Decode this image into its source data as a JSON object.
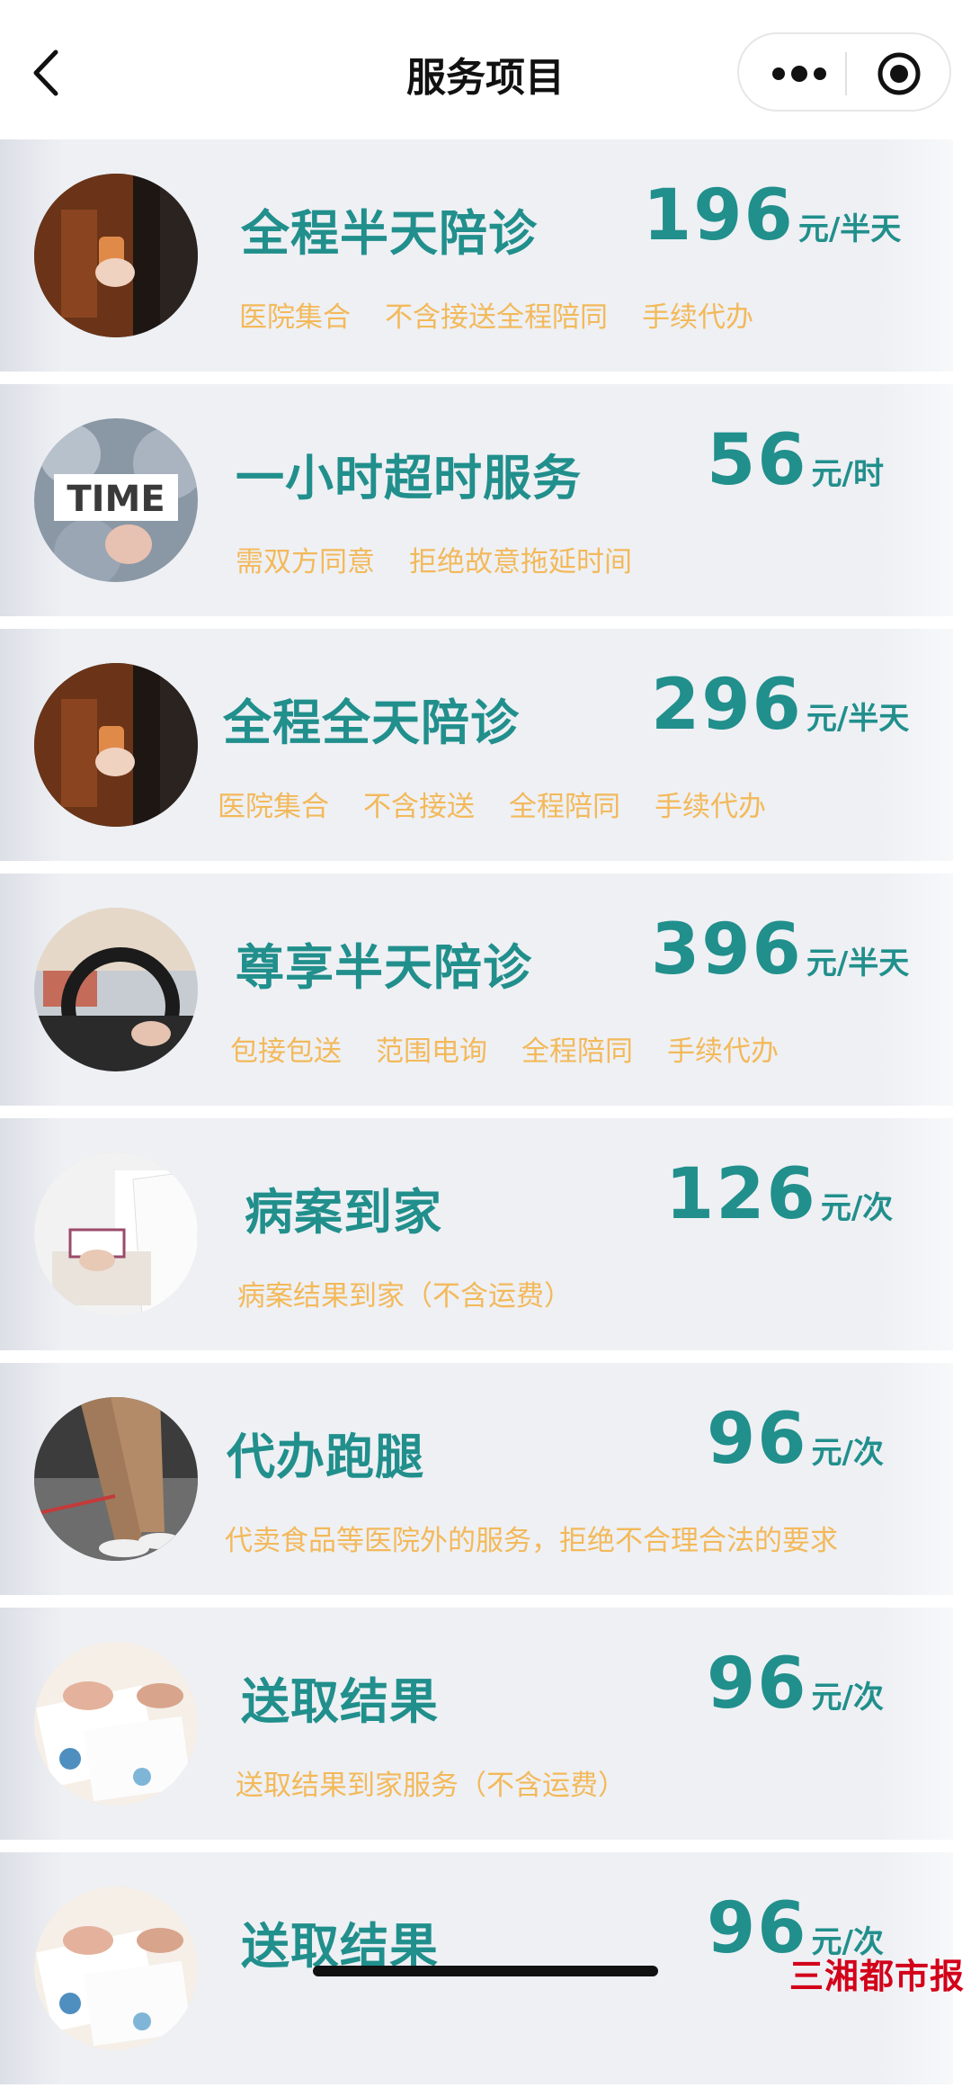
{
  "header": {
    "title": "服务项目",
    "back_icon": "chevron-left-icon",
    "more_icon": "more-dots-icon",
    "close_icon": "target-circle-icon"
  },
  "services": [
    {
      "name": "全程半天陪诊",
      "price": "196",
      "unit": "元/半天",
      "tags": [
        "医院集合",
        "不含接送全程陪同",
        "手续代办"
      ],
      "image": "hand-holding-card"
    },
    {
      "name": "一小时超时服务",
      "price": "56",
      "unit": "元/时",
      "tags": [
        "需双方同意",
        "拒绝故意拖延时间"
      ],
      "image": "time-clock-gears"
    },
    {
      "name": "全程全天陪诊",
      "price": "296",
      "unit": "元/半天",
      "tags": [
        "医院集合",
        "不含接送",
        "全程陪同",
        "手续代办"
      ],
      "image": "hand-holding-card"
    },
    {
      "name": "尊享半天陪诊",
      "price": "396",
      "unit": "元/半天",
      "tags": [
        "包接包送",
        "范围电询",
        "全程陪同",
        "手续代办"
      ],
      "image": "car-steering-wheel"
    },
    {
      "name": "病案到家",
      "price": "126",
      "unit": "元/次",
      "tags": [
        "病案结果到家（不含运费）"
      ],
      "image": "doctor-writing"
    },
    {
      "name": "代办跑腿",
      "price": "96",
      "unit": "元/次",
      "tags": [
        "代卖食品等医院外的服务，拒绝不合理合法的要求"
      ],
      "image": "walking-legs"
    },
    {
      "name": "送取结果",
      "price": "96",
      "unit": "元/次",
      "tags": [
        "送取结果到家服务（不含运费）"
      ],
      "image": "documents-on-desk"
    },
    {
      "name": "送取结果",
      "price": "96",
      "unit": "元/次",
      "tags": [],
      "image": "documents-on-desk"
    }
  ],
  "watermark": "三湘都市报"
}
